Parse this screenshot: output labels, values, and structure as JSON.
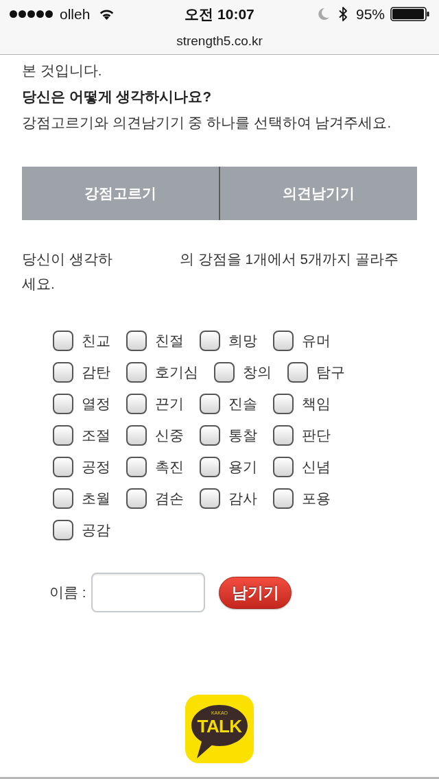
{
  "status_bar": {
    "carrier": "olleh",
    "time": "오전 10:07",
    "battery_percent": "95%"
  },
  "address_bar": {
    "url": "strength5.co.kr"
  },
  "intro": [
    {
      "text": "본 것입니다.",
      "bold": false
    },
    {
      "text": "당신은 어떻게 생각하시나요?",
      "bold": true
    },
    {
      "text": "강점고르기와 의견남기기 중 하나를 선택하여 남겨주세요.",
      "bold": false
    }
  ],
  "tabs": [
    {
      "label": "강점고르기"
    },
    {
      "label": "의견남기기"
    }
  ],
  "instruction": {
    "lines": [
      [
        "당신이 생각하",
        "의 강점을 1개에서 5개까지 골라주"
      ],
      [
        "세요."
      ]
    ]
  },
  "strengths": [
    {
      "label": "친교",
      "checked": false
    },
    {
      "label": "친절",
      "checked": false
    },
    {
      "label": "희망",
      "checked": false
    },
    {
      "label": "유머",
      "checked": false
    },
    {
      "label": "감탄",
      "checked": false
    },
    {
      "label": "호기심",
      "checked": false
    },
    {
      "label": "창의",
      "checked": false
    },
    {
      "label": "탐구",
      "checked": false
    },
    {
      "label": "열정",
      "checked": false
    },
    {
      "label": "끈기",
      "checked": false
    },
    {
      "label": "진솔",
      "checked": false
    },
    {
      "label": "책임",
      "checked": false
    },
    {
      "label": "조절",
      "checked": false
    },
    {
      "label": "신중",
      "checked": false
    },
    {
      "label": "통찰",
      "checked": false
    },
    {
      "label": "판단",
      "checked": false
    },
    {
      "label": "공정",
      "checked": false
    },
    {
      "label": "촉진",
      "checked": false
    },
    {
      "label": "용기",
      "checked": false
    },
    {
      "label": "신념",
      "checked": false
    },
    {
      "label": "초월",
      "checked": false
    },
    {
      "label": "겸손",
      "checked": false
    },
    {
      "label": "감사",
      "checked": false
    },
    {
      "label": "포용",
      "checked": false
    },
    {
      "label": "공감",
      "checked": false
    }
  ],
  "name_form": {
    "label": "이름 :",
    "button": "남기기"
  },
  "share": {
    "small_text": "KAKAO",
    "text": "TALK"
  }
}
